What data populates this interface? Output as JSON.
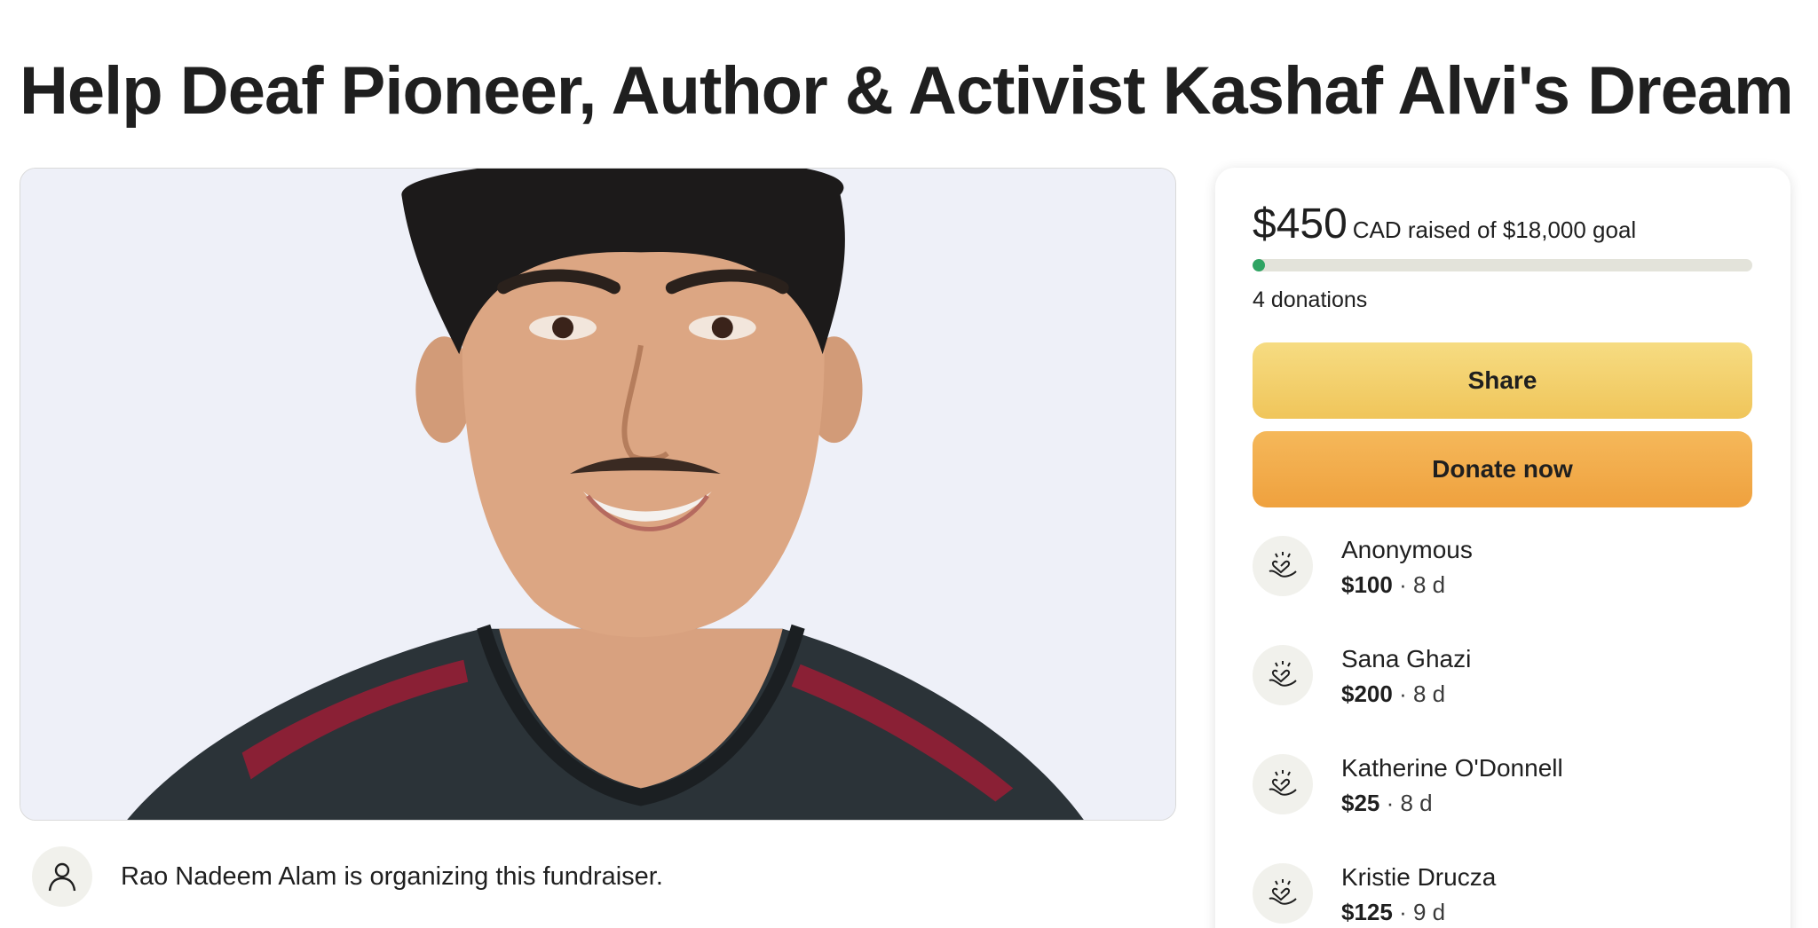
{
  "title": "Help Deaf Pioneer, Author & Activist Kashaf Alvi's Dream",
  "organizer": {
    "text": "Rao Nadeem Alam is organizing this fundraiser.",
    "icon": "person-icon"
  },
  "card": {
    "raised_amount": "$450",
    "raised_rest": "CAD raised of $18,000 goal",
    "progress_fraction": 0.025,
    "progress_color": "#2fa463",
    "donations_count": "4 donations",
    "share_label": "Share",
    "donate_label": "Donate now",
    "donors": [
      {
        "name": "Anonymous",
        "amount": "$100",
        "time": "8 d"
      },
      {
        "name": "Sana Ghazi",
        "amount": "$200",
        "time": "8 d"
      },
      {
        "name": "Katherine O'Donnell",
        "amount": "$25",
        "time": "8 d"
      },
      {
        "name": "Kristie Drucza",
        "amount": "$125",
        "time": "9 d"
      }
    ]
  },
  "colors": {
    "share_button": "#f0c55a",
    "donate_button": "#efa13e"
  }
}
